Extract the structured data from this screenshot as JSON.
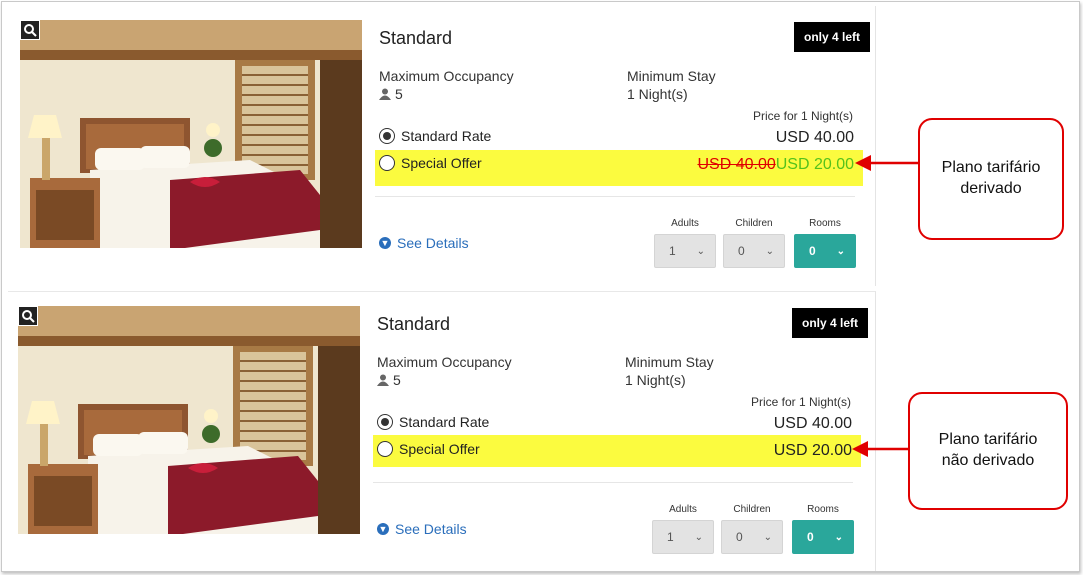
{
  "cards": [
    {
      "room_name": "Standard",
      "availability_badge": "only 4 left",
      "occupancy_label": "Maximum Occupancy",
      "occupancy_value": "5",
      "min_stay_label": "Minimum Stay",
      "min_stay_value": "1 Night(s)",
      "price_for": "Price for 1 Night(s)",
      "rates": [
        {
          "name": "Standard Rate",
          "price": "USD 40.00",
          "selected": true
        },
        {
          "name": "Special Offer",
          "old_price": "USD 40.00",
          "price": "USD 20.00",
          "selected": false
        }
      ],
      "details_link": "See Details",
      "adults_label": "Adults",
      "adults_value": "1",
      "children_label": "Children",
      "children_value": "0",
      "rooms_label": "Rooms",
      "rooms_value": "0"
    },
    {
      "room_name": "Standard",
      "availability_badge": "only 4 left",
      "occupancy_label": "Maximum Occupancy",
      "occupancy_value": "5",
      "min_stay_label": "Minimum Stay",
      "min_stay_value": "1 Night(s)",
      "price_for": "Price for 1 Night(s)",
      "rates": [
        {
          "name": "Standard Rate",
          "price": "USD 40.00",
          "selected": true
        },
        {
          "name": "Special Offer",
          "price": "USD 20.00",
          "selected": false
        }
      ],
      "details_link": "See Details",
      "adults_label": "Adults",
      "adults_value": "1",
      "children_label": "Children",
      "children_value": "0",
      "rooms_label": "Rooms",
      "rooms_value": "0"
    }
  ],
  "callouts": [
    {
      "text_line1": "Plano tarifário",
      "text_line2": "derivado"
    },
    {
      "text_line1": "Plano tarifário",
      "text_line2": "não derivado"
    }
  ],
  "colors": {
    "highlight": "#fbfb3f",
    "accent_teal": "#2aa79b",
    "strike_red": "#e00000",
    "discount_green": "#55c21b",
    "link_blue": "#2a6ebb",
    "callout_red": "#e00000"
  },
  "icons": {
    "zoom": "magnifier-icon",
    "person": "person-icon",
    "details": "chevron-circle-down-icon",
    "dropdown": "chevron-down-icon"
  }
}
